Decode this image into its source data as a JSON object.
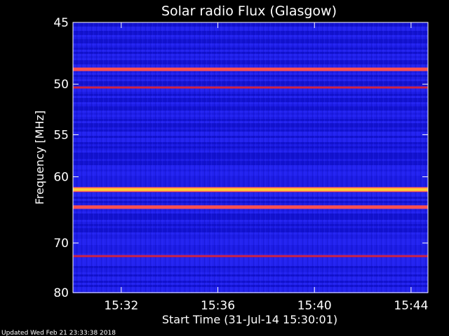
{
  "chart_data": {
    "type": "heatmap",
    "title": "Solar radio Flux (Glasgow)",
    "xlabel": "Start Time (31-Jul-14 15:30:01)",
    "ylabel": "Frequency [MHz]",
    "x_ticks": [
      "15:32",
      "15:36",
      "15:40",
      "15:44"
    ],
    "x_tick_minutes": [
      2,
      6,
      10,
      14
    ],
    "x_range_minutes": [
      0,
      14.7
    ],
    "y_ticks": [
      45,
      50,
      55,
      60,
      70,
      80
    ],
    "y_range": [
      45,
      80
    ],
    "y_scale": "reciprocal",
    "colors": {
      "background": "#1a1ae0",
      "band_hot": "#ffcc33",
      "band_warm": "#ff5050",
      "band_cool": "#cc2244"
    },
    "emission_bands": [
      {
        "freq_mhz": 48.7,
        "intensity": "warm"
      },
      {
        "freq_mhz": 50.3,
        "intensity": "cool"
      },
      {
        "freq_mhz": 61.7,
        "intensity": "hot"
      },
      {
        "freq_mhz": 64.2,
        "intensity": "warm"
      },
      {
        "freq_mhz": 72.4,
        "intensity": "cool"
      }
    ]
  },
  "footer": "Updated Wed Feb 21 23:33:38 2018"
}
